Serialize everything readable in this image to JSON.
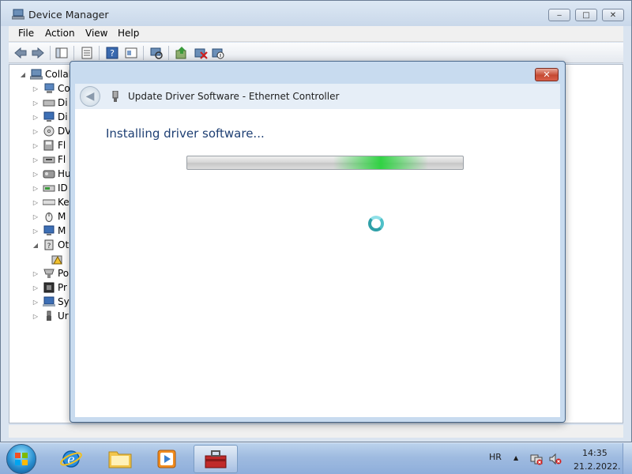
{
  "window": {
    "title": "Device Manager",
    "minimize": "‒",
    "maximize": "□",
    "close": "✕"
  },
  "menu": {
    "file": "File",
    "action": "Action",
    "view": "View",
    "help": "Help"
  },
  "tree": {
    "root": "Collab",
    "items": [
      "Co",
      "Di",
      "Di",
      "DV",
      "Fl",
      "Fl",
      "Hu",
      "ID",
      "Ke",
      "M",
      "M",
      "Ot",
      "",
      "Po",
      "Pr",
      "Sy",
      "Ur"
    ]
  },
  "dialog": {
    "close": "✕",
    "back": "◀",
    "header_title": "Update Driver Software - Ethernet Controller",
    "status_text": "Installing driver software..."
  },
  "taskbar": {
    "language": "HR",
    "tray_arrow": "▲",
    "time": "14:35",
    "date": "21.2.2022."
  },
  "colors": {
    "accent_blue": "#1e3f73",
    "progress_green": "#28d23c",
    "close_red": "#c64a33"
  }
}
